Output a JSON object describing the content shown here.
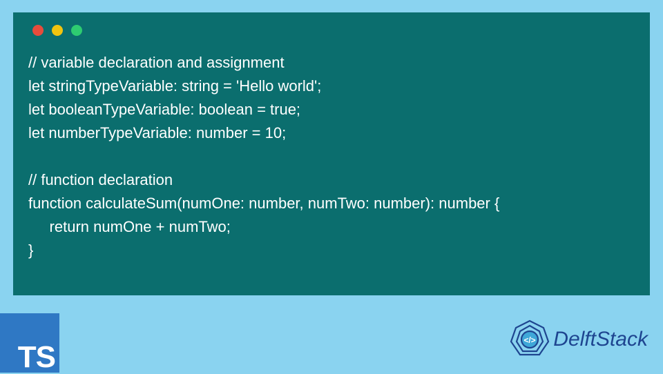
{
  "code": {
    "line1": "// variable declaration and assignment",
    "line2": "let stringTypeVariable: string = 'Hello world';",
    "line3": "let booleanTypeVariable: boolean = true;",
    "line4": "let numberTypeVariable: number = 10;",
    "line5": "",
    "line6": "// function declaration",
    "line7": "function calculateSum(numOne: number, numTwo: number): number {",
    "line8": "     return numOne + numTwo;",
    "line9": "}"
  },
  "badge": {
    "text": "TS"
  },
  "brand": {
    "name": "DelftStack"
  },
  "colors": {
    "bg": "#8ad3f0",
    "panel": "#0b6e6e",
    "badge": "#2f78c4",
    "brand": "#1e4590"
  }
}
